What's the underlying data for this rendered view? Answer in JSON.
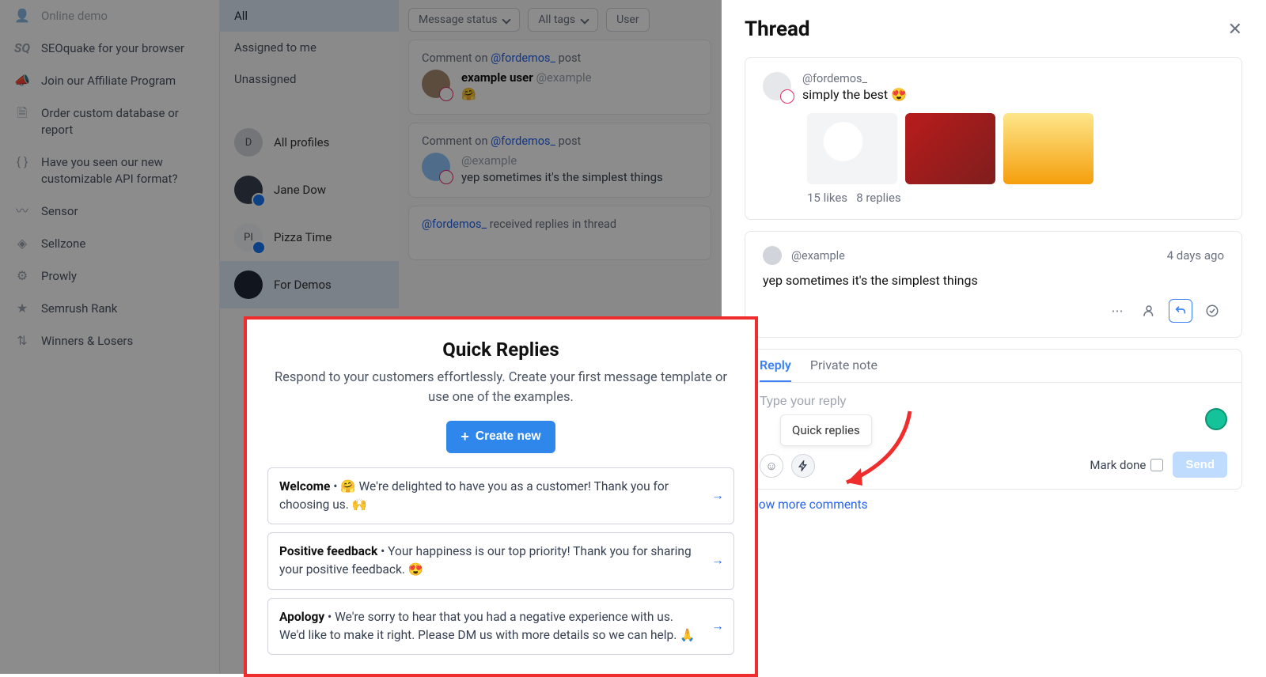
{
  "sidebar": {
    "items": [
      {
        "label": "Online demo"
      },
      {
        "label": "SEOquake for your browser"
      },
      {
        "label": "Join our Affiliate Program"
      },
      {
        "label": "Order custom database or report"
      },
      {
        "label": "Have you seen our new customizable API format?"
      },
      {
        "label": "Sensor"
      },
      {
        "label": "Sellzone"
      },
      {
        "label": "Prowly"
      },
      {
        "label": "Semrush Rank"
      },
      {
        "label": "Winners & Losers"
      }
    ]
  },
  "filters": {
    "items": [
      {
        "label": "All"
      },
      {
        "label": "Assigned to me"
      },
      {
        "label": "Unassigned"
      }
    ],
    "profiles": [
      {
        "label": "All profiles",
        "initial": "D"
      },
      {
        "label": "Jane Dow"
      },
      {
        "label": "Pizza Time",
        "initial": "PI"
      },
      {
        "label": "For Demos"
      }
    ]
  },
  "feed_filters": {
    "status": "Message status",
    "tags": "All tags",
    "user": "User"
  },
  "feed": [
    {
      "meta_prefix": "Comment on ",
      "meta_handle": "@fordemos_",
      "meta_suffix": " post",
      "user": "example user",
      "handle": "@example",
      "body_emoji": "🤗"
    },
    {
      "meta_prefix": "Comment on ",
      "meta_handle": "@fordemos_",
      "meta_suffix": " post",
      "user": "",
      "handle": "@example",
      "body": "yep sometimes it's the simplest things"
    },
    {
      "meta_handle": "@fordemos_",
      "meta_suffix": " received replies in thread"
    }
  ],
  "thread": {
    "title": "Thread",
    "op": {
      "handle": "@fordemos_",
      "msg": "simply the best 😍",
      "likes": "15 likes",
      "replies": "8 replies"
    },
    "reply": {
      "handle": "@example",
      "ago": "4 days ago",
      "body": "yep sometimes it's the simplest things"
    },
    "composer": {
      "tab_reply": "Reply",
      "tab_private": "Private note",
      "placeholder": "Type your reply",
      "qr_tooltip": "Quick replies",
      "mark_done": "Mark done",
      "send": "Send"
    },
    "show_more": "Show more comments"
  },
  "quick_replies": {
    "title": "Quick Replies",
    "subtitle": "Respond to your customers effortlessly. Create your first message template or use one of the examples.",
    "create": "Create new",
    "templates": [
      {
        "name": "Welcome",
        "sep": " • ",
        "emoji_pre": "🤗 ",
        "body": "We're delighted to have you as a customer! Thank you for choosing us. 🙌"
      },
      {
        "name": "Positive feedback",
        "sep": " • ",
        "emoji_pre": "",
        "body": "Your happiness is our top priority! Thank you for sharing your positive feedback. 😍"
      },
      {
        "name": "Apology",
        "sep": " • ",
        "emoji_pre": "",
        "body": "We're sorry to hear that you had a negative experience with us. We'd like to make it right. Please DM us with more details so we can help. 🙏"
      }
    ]
  }
}
